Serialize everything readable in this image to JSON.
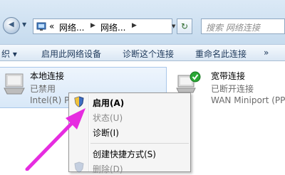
{
  "address_bar": {
    "breadcrumb": [
      "«",
      "网络...",
      "网络..."
    ],
    "search_placeholder": "搜索 网络连接"
  },
  "toolbar": {
    "items": [
      "织 ▾",
      "启用此网络设备",
      "诊断这个连接",
      "重命名此连接",
      "»"
    ]
  },
  "connections": [
    {
      "name": "本地连接",
      "status": "已禁用",
      "device": "Intel(R) P"
    },
    {
      "name": "宽带连接",
      "status": "已断开连接",
      "device": "WAN Miniport (PP"
    }
  ],
  "context_menu": {
    "items": [
      {
        "label": "启用(A)",
        "bold": true,
        "disabled": false,
        "icon": "shield-icon"
      },
      {
        "label": "状态(U)",
        "bold": false,
        "disabled": true
      },
      {
        "label": "诊断(I)",
        "bold": false,
        "disabled": false
      },
      {
        "label": "创建快捷方式(S)",
        "bold": false,
        "disabled": false
      },
      {
        "label": "删除(D)",
        "bold": false,
        "disabled": true,
        "icon": "shield-icon"
      }
    ]
  },
  "colors": {
    "annotation_arrow": "#e62ce0",
    "check_badge": "#2aa836",
    "command_text": "#1e395b"
  }
}
